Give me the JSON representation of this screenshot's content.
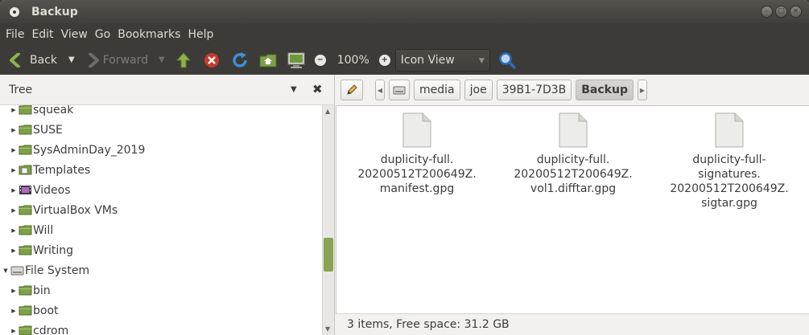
{
  "window": {
    "title": "Backup"
  },
  "menubar": {
    "items": [
      "File",
      "Edit",
      "View",
      "Go",
      "Bookmarks",
      "Help"
    ]
  },
  "toolbar": {
    "back_label": "Back",
    "forward_label": "Forward",
    "zoom": "100%",
    "view_mode": "Icon View",
    "icons": [
      "go-up-icon",
      "stop-icon",
      "reload-icon",
      "home-icon",
      "computer-icon",
      "zoom-out-icon",
      "zoom-in-icon",
      "search-icon"
    ]
  },
  "sidebar": {
    "title": "Tree",
    "items": [
      {
        "label": "squeak",
        "icon": "folder",
        "indent": 1
      },
      {
        "label": "SUSE",
        "icon": "folder",
        "indent": 1
      },
      {
        "label": "SysAdminDay_2019",
        "icon": "folder",
        "indent": 1
      },
      {
        "label": "Templates",
        "icon": "templates-folder",
        "indent": 1
      },
      {
        "label": "Videos",
        "icon": "videos-folder",
        "indent": 1
      },
      {
        "label": "VirtualBox VMs",
        "icon": "folder",
        "indent": 1
      },
      {
        "label": "Will",
        "icon": "folder",
        "indent": 1
      },
      {
        "label": "Writing",
        "icon": "folder",
        "indent": 1
      },
      {
        "label": "File System",
        "icon": "drive",
        "indent": 0,
        "expanded": true
      },
      {
        "label": "bin",
        "icon": "folder",
        "indent": 1
      },
      {
        "label": "boot",
        "icon": "folder",
        "indent": 1
      },
      {
        "label": "cdrom",
        "icon": "folder",
        "indent": 1
      }
    ]
  },
  "pathbar": {
    "segments": [
      "media",
      "joe",
      "39B1-7D3B",
      "Backup"
    ],
    "active": "Backup"
  },
  "files": [
    {
      "lines": [
        "duplicity-full.",
        "20200512T200649Z.",
        "manifest.gpg"
      ]
    },
    {
      "lines": [
        "duplicity-full.",
        "20200512T200649Z.",
        "vol1.difftar.gpg"
      ]
    },
    {
      "lines": [
        "duplicity-full-",
        "signatures.",
        "20200512T200649Z.",
        "sigtar.gpg"
      ]
    }
  ],
  "status": {
    "text": "3 items, Free space: 31.2 GB"
  },
  "colors": {
    "folder_green": "#7fa04a",
    "scroll_thumb": "#87a552",
    "titlebar": "#3c3b37"
  }
}
